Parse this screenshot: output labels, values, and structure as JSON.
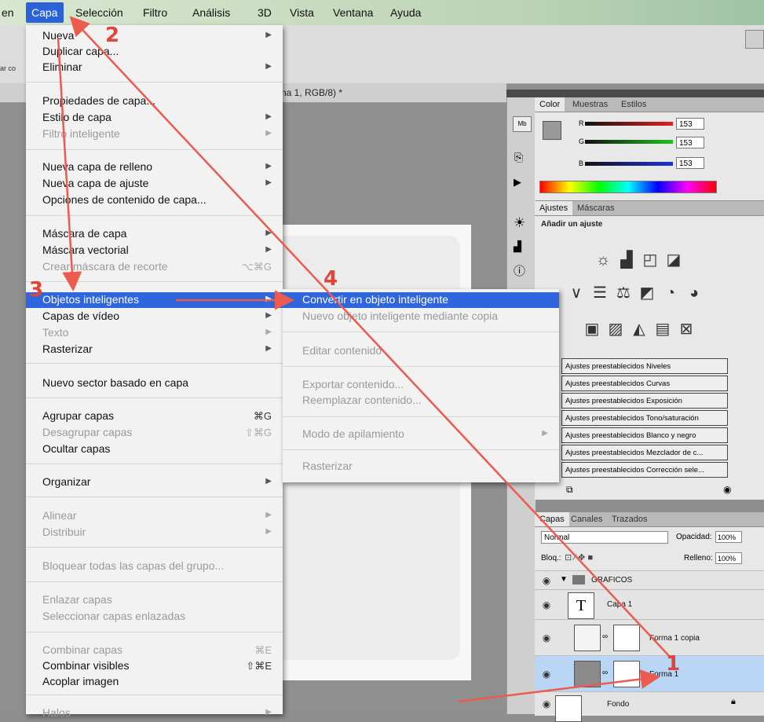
{
  "menubar": {
    "items": [
      "en",
      "Capa",
      "Selección",
      "Filtro",
      "Análisis",
      "3D",
      "Vista",
      "Ventana",
      "Ayuda"
    ],
    "active": "Capa"
  },
  "options_bar": {
    "left_label": "ar co",
    "right_glyphs": "▣ ┃┃ ≡"
  },
  "document": {
    "tab_title": "na 1, RGB/8) *"
  },
  "layer_menu": {
    "items": [
      {
        "label": "Nueva",
        "submenu": true,
        "enabled": true
      },
      {
        "label": "Duplicar capa...",
        "enabled": true
      },
      {
        "label": "Eliminar",
        "submenu": true,
        "enabled": true
      },
      {
        "label": "Propiedades de capa...",
        "enabled": true
      },
      {
        "label": "Estilo de capa",
        "submenu": true,
        "enabled": true
      },
      {
        "label": "Filtro inteligente",
        "submenu": true,
        "enabled": false
      },
      {
        "label": "Nueva capa de relleno",
        "submenu": true,
        "enabled": true
      },
      {
        "label": "Nueva capa de ajuste",
        "submenu": true,
        "enabled": true
      },
      {
        "label": "Opciones de contenido de capa...",
        "enabled": true
      },
      {
        "label": "Máscara de capa",
        "submenu": true,
        "enabled": true
      },
      {
        "label": "Máscara vectorial",
        "submenu": true,
        "enabled": true
      },
      {
        "label": "Crear máscara de recorte",
        "shortcut": "⌥⌘G",
        "enabled": false
      },
      {
        "label": "Objetos inteligentes",
        "submenu": true,
        "enabled": true,
        "highlighted": true
      },
      {
        "label": "Capas de vídeo",
        "submenu": true,
        "enabled": true
      },
      {
        "label": "Texto",
        "submenu": true,
        "enabled": false
      },
      {
        "label": "Rasterizar",
        "submenu": true,
        "enabled": true
      },
      {
        "label": "Nuevo sector basado en capa",
        "enabled": true
      },
      {
        "label": "Agrupar capas",
        "shortcut": "⌘G",
        "enabled": true
      },
      {
        "label": "Desagrupar capas",
        "shortcut": "⇧⌘G",
        "enabled": false
      },
      {
        "label": "Ocultar capas",
        "enabled": true
      },
      {
        "label": "Organizar",
        "submenu": true,
        "enabled": true
      },
      {
        "label": "Alinear",
        "submenu": true,
        "enabled": false
      },
      {
        "label": "Distribuir",
        "submenu": true,
        "enabled": false
      },
      {
        "label": "Bloquear todas las capas del grupo...",
        "enabled": false
      },
      {
        "label": "Enlazar capas",
        "enabled": false
      },
      {
        "label": "Seleccionar capas enlazadas",
        "enabled": false
      },
      {
        "label": "Combinar capas",
        "shortcut": "⌘E",
        "enabled": false
      },
      {
        "label": "Combinar visibles",
        "shortcut": "⇧⌘E",
        "enabled": true
      },
      {
        "label": "Acoplar imagen",
        "enabled": true
      },
      {
        "label": "Halos",
        "submenu": true,
        "enabled": false
      }
    ]
  },
  "smart_object_submenu": {
    "items": [
      {
        "label": "Convertir en objeto inteligente",
        "enabled": true,
        "highlighted": true
      },
      {
        "label": "Nuevo objeto inteligente mediante copia",
        "enabled": false
      },
      {
        "label": "Editar contenido",
        "enabled": false
      },
      {
        "label": "Exportar contenido...",
        "enabled": false
      },
      {
        "label": "Reemplazar contenido...",
        "enabled": false
      },
      {
        "label": "Modo de apilamiento",
        "submenu": true,
        "enabled": false
      },
      {
        "label": "Rasterizar",
        "enabled": false
      }
    ]
  },
  "color_panel": {
    "tabs": [
      "Color",
      "Muestras",
      "Estilos"
    ],
    "channels": [
      {
        "name": "R",
        "value": "153"
      },
      {
        "name": "G",
        "value": "153"
      },
      {
        "name": "B",
        "value": "153"
      }
    ]
  },
  "adjustments_panel": {
    "tabs": [
      "Ajustes",
      "Máscaras"
    ],
    "heading": "Añadir un ajuste",
    "presets": [
      "Ajustes preestablecidos Niveles",
      "Ajustes preestablecidos Curvas",
      "Ajustes preestablecidos Exposición",
      "Ajustes preestablecidos Tono/saturación",
      "Ajustes preestablecidos Blanco y negro",
      "Ajustes preestablecidos Mezclador de c...",
      "Ajustes preestablecidos Corrección sele..."
    ]
  },
  "layers_panel": {
    "tabs": [
      "Capas",
      "Canales",
      "Trazados"
    ],
    "blend_mode": "Normal",
    "opacity_label": "Opacidad:",
    "opacity": "100%",
    "lock_label": "Bloq.:",
    "fill_label": "Relleno:",
    "fill": "100%",
    "layers": [
      {
        "name": "GRAFICOS",
        "type": "group"
      },
      {
        "name": "Capa 1",
        "type": "text",
        "thumb": "T"
      },
      {
        "name": "Forma 1 copia",
        "type": "shape"
      },
      {
        "name": "Forma 1",
        "type": "shape",
        "selected": true
      },
      {
        "name": "Fondo",
        "type": "background"
      }
    ]
  },
  "annotations": {
    "steps": [
      "1",
      "2",
      "3",
      "4"
    ],
    "color": "#e0443a"
  },
  "colors": {
    "highlight": "#2f66de",
    "menu_bg": "#f2f2f2",
    "selected_layer": "#b9d7f5"
  }
}
